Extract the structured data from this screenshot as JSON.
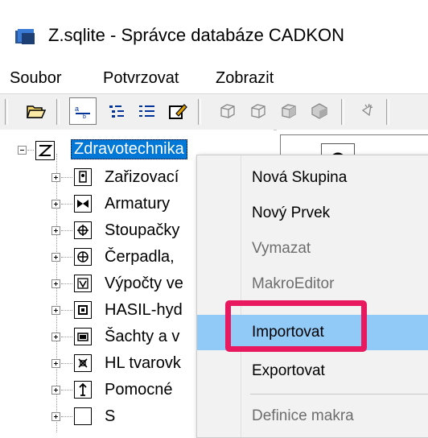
{
  "window": {
    "title": "Z.sqlite - Správce databáze CADKON"
  },
  "menubar": {
    "items": [
      "Soubor",
      "Potvrzovat",
      "Zobrazit"
    ]
  },
  "toolbar": {
    "buttons": [
      "open-folder-icon",
      "view-list-icon",
      "view-tree-icon",
      "view-detail-icon",
      "edit-icon",
      "cube-wire-icon",
      "cube-icon",
      "cube-shade-icon",
      "cube-solid-icon",
      "cursor-icon"
    ]
  },
  "tree": {
    "root": {
      "label": "Zdravotechnika",
      "icon": "zigzag-icon",
      "expanded": true
    },
    "children": [
      {
        "label": "Zařizovací",
        "icon": "fixture-icon"
      },
      {
        "label": "Armatury",
        "icon": "valve-icon"
      },
      {
        "label": "Stoupačky",
        "icon": "riser-icon"
      },
      {
        "label": "Čerpadla, ",
        "icon": "pump-icon"
      },
      {
        "label": "Výpočty ve",
        "icon": "calc-icon"
      },
      {
        "label": "HASIL-hyd",
        "icon": "hydrant-icon"
      },
      {
        "label": "Šachty a v",
        "icon": "shaft-icon"
      },
      {
        "label": "HL tvarovk",
        "icon": "fitting-icon"
      },
      {
        "label": "Pomocné ",
        "icon": "arrow-up-icon"
      },
      {
        "label": "S",
        "icon": "misc-icon"
      }
    ]
  },
  "context_menu": {
    "items": [
      {
        "label": "Nová Skupina",
        "enabled": true
      },
      {
        "label": "Nový Prvek",
        "enabled": true
      },
      {
        "label": "Vymazat",
        "enabled": false
      },
      {
        "label": "MakroEditor",
        "enabled": false
      },
      {
        "label": "Importovat",
        "enabled": true,
        "hovered": true
      },
      {
        "label": "Exportovat",
        "enabled": true
      },
      {
        "label": "Definice makra",
        "enabled": false
      }
    ]
  },
  "colors": {
    "selection": "#0078d7",
    "menu_hover": "#91c9f7",
    "highlight_box": "#e8195f",
    "menu_bg": "#f2f2f2"
  }
}
